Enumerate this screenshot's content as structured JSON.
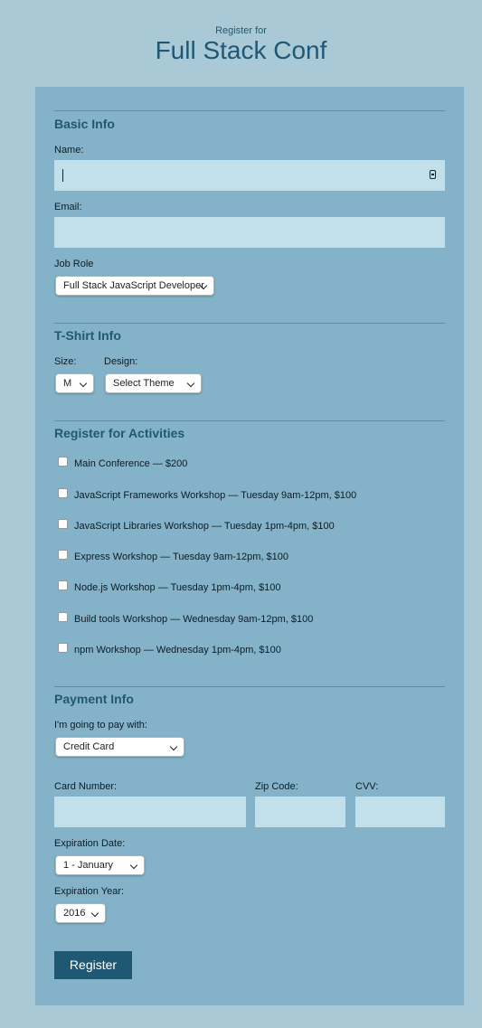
{
  "header": {
    "subtitle": "Register for",
    "title": "Full Stack Conf"
  },
  "basic_info": {
    "title": "Basic Info",
    "name_label": "Name:",
    "name_value": "",
    "email_label": "Email:",
    "email_value": "",
    "job_role_label": "Job Role",
    "job_role_selected": "Full Stack JavaScript Developer"
  },
  "tshirt": {
    "title": "T-Shirt Info",
    "size_label": "Size:",
    "size_selected": "M",
    "design_label": "Design:",
    "design_selected": "Select Theme"
  },
  "activities": {
    "title": "Register for Activities",
    "items": [
      {
        "label": "Main Conference — $200",
        "checked": false
      },
      {
        "label": "JavaScript Frameworks Workshop — Tuesday 9am-12pm, $100",
        "checked": false
      },
      {
        "label": "JavaScript Libraries Workshop — Tuesday 1pm-4pm, $100",
        "checked": false
      },
      {
        "label": "Express Workshop — Tuesday 9am-12pm, $100",
        "checked": false
      },
      {
        "label": "Node.js Workshop — Tuesday 1pm-4pm, $100",
        "checked": false
      },
      {
        "label": "Build tools Workshop — Wednesday 9am-12pm, $100",
        "checked": false
      },
      {
        "label": "npm Workshop — Wednesday 1pm-4pm, $100",
        "checked": false
      }
    ]
  },
  "payment": {
    "title": "Payment Info",
    "method_label": "I'm going to pay with:",
    "method_selected": "Credit Card",
    "card_number_label": "Card Number:",
    "zip_label": "Zip Code:",
    "cvv_label": "CVV:",
    "exp_date_label": "Expiration Date:",
    "exp_date_selected": "1 - January",
    "exp_year_label": "Expiration Year:",
    "exp_year_selected": "2016"
  },
  "submit_label": "Register",
  "colors": {
    "page_bg": "#a9c9d7",
    "panel_bg": "#84b3c9",
    "input_bg": "#c1e0eb",
    "accent": "#1f5873"
  }
}
